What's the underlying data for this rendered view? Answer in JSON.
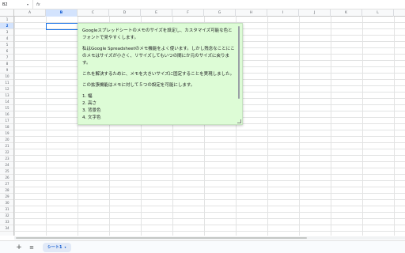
{
  "formula_bar": {
    "name_box": "B2",
    "name_box_caret": "▾",
    "fx": "fx"
  },
  "columns": [
    "A",
    "B",
    "C",
    "D",
    "E",
    "F",
    "G",
    "H",
    "I",
    "J",
    "K",
    "L"
  ],
  "selected_column": "B",
  "rows": [
    "1",
    "2",
    "3",
    "4",
    "5",
    "6",
    "7",
    "8",
    "9",
    "10",
    "11",
    "12",
    "13",
    "14",
    "15",
    "16",
    "17",
    "18",
    "19",
    "20",
    "21",
    "22",
    "23",
    "24",
    "25",
    "26",
    "27",
    "28",
    "29",
    "30",
    "31",
    "32",
    "33",
    "34"
  ],
  "selected_row": "2",
  "note": {
    "paragraph_1": "Googleスプレッドシートのメモのサイズを設定し、カスタマイズ可能な色とフォントで見やすくします。",
    "paragraph_2": "私はGoogle Spreadsheetのメモ機能をよく使います。しかし残念なことにこのメモはサイズが小さく、リサイズしてもいつの間にか元のサイズに戻ります。",
    "paragraph_3": "これを解決するために、メモを大きいサイズに固定することを実現しました。",
    "paragraph_4": "この拡張機能はメモに対して５つの設定を可能にします。",
    "list": [
      "1. 幅",
      "2. 高さ",
      "3. 背景色",
      "4. 文字色"
    ]
  },
  "sheet_tabs": {
    "add_icon": "+",
    "all_sheets_icon": "≡",
    "active_tab": "シート1",
    "tab_caret": "▾"
  },
  "colors": {
    "note_background": "#ddfcd6",
    "selection": "#1a73e8",
    "header_selected": "#d3e3fd"
  }
}
